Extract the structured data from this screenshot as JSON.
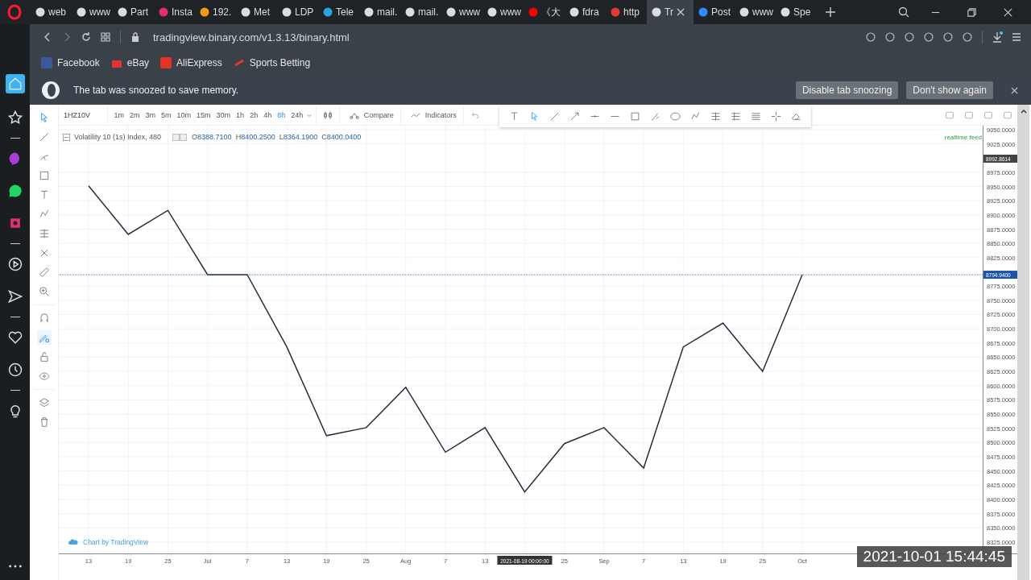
{
  "browser": {
    "tabs": [
      {
        "label": "web",
        "selected": false
      },
      {
        "label": "www",
        "selected": false
      },
      {
        "label": "Part",
        "selected": false
      },
      {
        "label": "Insta",
        "selected": false
      },
      {
        "label": "192.",
        "selected": false
      },
      {
        "label": "Met",
        "selected": false
      },
      {
        "label": "LDP",
        "selected": false
      },
      {
        "label": "Tele",
        "selected": false
      },
      {
        "label": "mail.",
        "selected": false
      },
      {
        "label": "mail.",
        "selected": false
      },
      {
        "label": "www",
        "selected": false
      },
      {
        "label": "www",
        "selected": false
      },
      {
        "label": "《大",
        "selected": false
      },
      {
        "label": "fdra",
        "selected": false
      },
      {
        "label": "http",
        "selected": false
      },
      {
        "label": "Tr",
        "selected": true
      },
      {
        "label": "Post",
        "selected": false
      },
      {
        "label": "www",
        "selected": false
      },
      {
        "label": "Spe",
        "selected": false
      }
    ],
    "address": "tradingview.binary.com/v1.3.13/binary.html",
    "bookmarks": [
      "Facebook",
      "eBay",
      "AliExpress",
      "Sports Betting"
    ]
  },
  "notice": {
    "message": "The tab was snoozed to save memory.",
    "buttons": [
      "Disable tab snoozing",
      "Don't show again"
    ]
  },
  "toolbar": {
    "symbol": "1HZ10V",
    "intervals": [
      {
        "label": "1m",
        "selected": false
      },
      {
        "label": "2m",
        "selected": false
      },
      {
        "label": "3m",
        "selected": false
      },
      {
        "label": "5m",
        "selected": false
      },
      {
        "label": "10m",
        "selected": false
      },
      {
        "label": "15m",
        "selected": false
      },
      {
        "label": "30m",
        "selected": false
      },
      {
        "label": "1h",
        "selected": false
      },
      {
        "label": "2h",
        "selected": false
      },
      {
        "label": "4h",
        "selected": false
      },
      {
        "label": "8h",
        "selected": true
      },
      {
        "label": "24h",
        "selected": false
      }
    ],
    "compare": "Compare",
    "indicators": "Indicators"
  },
  "legend": {
    "title": "Volatility 10 (1s) Index, 480",
    "ohlc": [
      {
        "key": "O",
        "value": "8388.7100"
      },
      {
        "key": "H",
        "value": "8400.2500"
      },
      {
        "key": "L",
        "value": "8364.1900"
      },
      {
        "key": "C",
        "value": "8400.0400"
      }
    ]
  },
  "realtime": "realtime feed",
  "attribution": "Chart by TradingView",
  "timestamp": "2021-10-01 15:44:45",
  "crosshair_date": "2021-08-19 00:00:00",
  "chart_data": {
    "type": "line",
    "grid": true,
    "categories": [
      "13",
      "19",
      "25",
      "Jul",
      "7",
      "13",
      "19",
      "25",
      "Aug",
      "7",
      "13",
      null,
      "25",
      "Sep",
      "7",
      "13",
      "19",
      "25",
      "Oct"
    ],
    "series": [
      {
        "color": "#2a2e39",
        "values": [
          8951,
          8866,
          8908,
          8795,
          8795,
          8668,
          8512,
          8526,
          8597,
          8483,
          8526,
          8413,
          8498,
          8526,
          8455,
          8668,
          8710,
          8625,
          8795
        ]
      }
    ],
    "ylim": [
      8305,
      9057
    ],
    "yticks": [
      {
        "value": 9050,
        "label": "9050.0000"
      },
      {
        "value": 9025,
        "label": "9025.0000"
      },
      {
        "value": 8975,
        "label": "8975.0000"
      },
      {
        "value": 8950,
        "label": "8950.0000"
      },
      {
        "value": 8925,
        "label": "8925.0000"
      },
      {
        "value": 8900,
        "label": "8900.0000"
      },
      {
        "value": 8875,
        "label": "8875.0000"
      },
      {
        "value": 8850,
        "label": "8850.0000"
      },
      {
        "value": 8825,
        "label": "8825.0000"
      },
      {
        "value": 8775,
        "label": "8775.0000"
      },
      {
        "value": 8750,
        "label": "8750.0000"
      },
      {
        "value": 8725,
        "label": "8725.0000"
      },
      {
        "value": 8700,
        "label": "8700.0000"
      },
      {
        "value": 8675,
        "label": "8675.0000"
      },
      {
        "value": 8650,
        "label": "8650.0000"
      },
      {
        "value": 8625,
        "label": "8625.0000"
      },
      {
        "value": 8600,
        "label": "8600.0000"
      },
      {
        "value": 8575,
        "label": "8575.0000"
      },
      {
        "value": 8550,
        "label": "8550.0000"
      },
      {
        "value": 8525,
        "label": "8525.0000"
      },
      {
        "value": 8500,
        "label": "8500.0000"
      },
      {
        "value": 8475,
        "label": "8475.0000"
      },
      {
        "value": 8450,
        "label": "8450.0000"
      },
      {
        "value": 8425,
        "label": "8425.0000"
      },
      {
        "value": 8400,
        "label": "8400.0000"
      },
      {
        "value": 8375,
        "label": "8375.0000"
      },
      {
        "value": 8350,
        "label": "8350.0000"
      },
      {
        "value": 8325,
        "label": "8325.0000"
      }
    ],
    "annotations": [
      "8992.8614"
    ],
    "ref_lines": [
      {
        "axis": "y",
        "value": 8794.94,
        "label": "8794.9400",
        "color": "#1e53a8"
      }
    ]
  }
}
